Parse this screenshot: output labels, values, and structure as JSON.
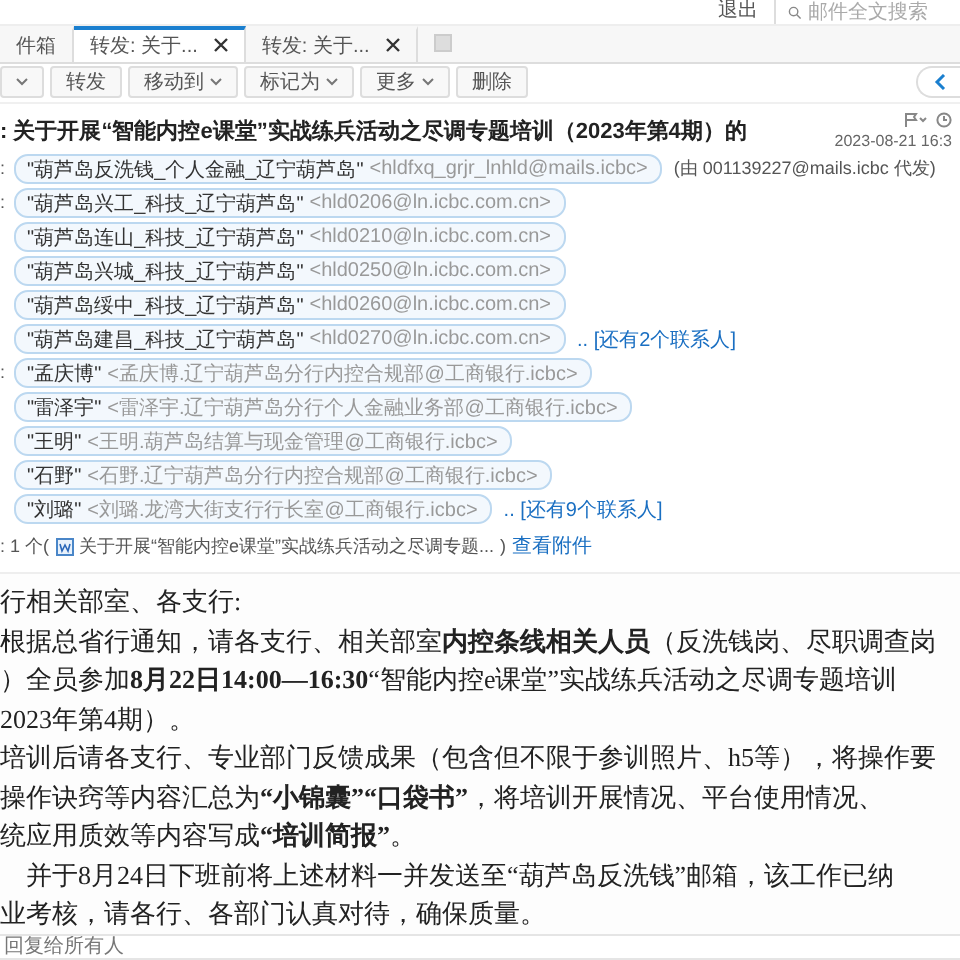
{
  "top_bar": {
    "logout": "退出",
    "search": {
      "placeholder": "邮件全文搜索"
    }
  },
  "tabs": [
    {
      "label": "件箱",
      "selected": false,
      "closable": false
    },
    {
      "label": "转发: 关于...",
      "selected": true,
      "closable": true
    },
    {
      "label": "转发: 关于...",
      "selected": false,
      "closable": true
    }
  ],
  "toolbar": [
    {
      "dropdown": true
    },
    {
      "label": "转发",
      "dropdown": false
    },
    {
      "label": "移动到",
      "dropdown": true
    },
    {
      "label": "标记为",
      "dropdown": true
    },
    {
      "label": "更多",
      "dropdown": true
    },
    {
      "label": "删除",
      "dropdown": false
    }
  ],
  "subject": ": 关于开展“智能内控e课堂”实战练兵活动之尽调专题培训（2023年第4期）的",
  "date": "2023-08-21 16:3",
  "from": {
    "label": ":",
    "contacts": [
      {
        "name": "\"葫芦岛反洗钱_个人金融_辽宁葫芦岛\"",
        "email": "<hldfxq_grjr_lnhld@mails.icbc>"
      }
    ],
    "note": "(由 001139227@mails.icbc 代发)"
  },
  "to": {
    "label": ":",
    "contacts": [
      {
        "name": "\"葫芦岛兴工_科技_辽宁葫芦岛\"",
        "email": "<hld0206@ln.icbc.com.cn>"
      },
      {
        "name": "\"葫芦岛连山_科技_辽宁葫芦岛\"",
        "email": "<hld0210@ln.icbc.com.cn>"
      },
      {
        "name": "\"葫芦岛兴城_科技_辽宁葫芦岛\"",
        "email": "<hld0250@ln.icbc.com.cn>"
      },
      {
        "name": "\"葫芦岛绥中_科技_辽宁葫芦岛\"",
        "email": "<hld0260@ln.icbc.com.cn>"
      },
      {
        "name": "\"葫芦岛建昌_科技_辽宁葫芦岛\"",
        "email": "<hld0270@ln.icbc.com.cn>"
      }
    ],
    "more": ".. [还有2个联系人]"
  },
  "cc": {
    "label": ":",
    "contacts": [
      {
        "name": "\"孟庆博\"",
        "email": "<孟庆博.辽宁葫芦岛分行内控合规部@工商银行.icbc>"
      },
      {
        "name": "\"雷泽宇\"",
        "email": "<雷泽宇.辽宁葫芦岛分行个人金融业务部@工商银行.icbc>"
      },
      {
        "name": "\"王明\"",
        "email": "<王明.葫芦岛结算与现金管理@工商银行.icbc>"
      },
      {
        "name": "\"石野\"",
        "email": "<石野.辽宁葫芦岛分行内控合规部@工商银行.icbc>"
      },
      {
        "name": "\"刘璐\"",
        "email": "<刘璐.龙湾大街支行行长室@工商银行.icbc>"
      }
    ],
    "more": ".. [还有9个联系人]"
  },
  "attachment": {
    "label": ": 1 个(",
    "name": "关于开展“智能内控e课堂”实战练兵活动之尽调专题...",
    "close": ")",
    "link": "查看附件"
  },
  "body": [
    "行相关部室、各支行:",
    "根据总省行通知，请各支行、相关部室**内控条线相关人员**（反洗钱岗、尽职调查岗",
    "）全员参加**8月22日14:00—16:30**“智能内控e课堂”实战练兵活动之尽调专题培训",
    "2023年第4期）。",
    "培训后请各支行、专业部门反馈成果（包含但不限于参训照片、h5等），将操作要",
    "操作诀窍等内容汇总为**“小锦囊”“口袋书”**，将培训开展情况、平台使用情况、",
    "统应用质效等内容写成**“培训简报”**。",
    "　并于8月24日下班前将上述材料一并发送至“葫芦岛反洗钱”邮箱，该工作已纳",
    "业考核，请各行、各部门认真对待，确保质量。"
  ],
  "quick_reply": {
    "placeholder": "回复给所有人"
  }
}
